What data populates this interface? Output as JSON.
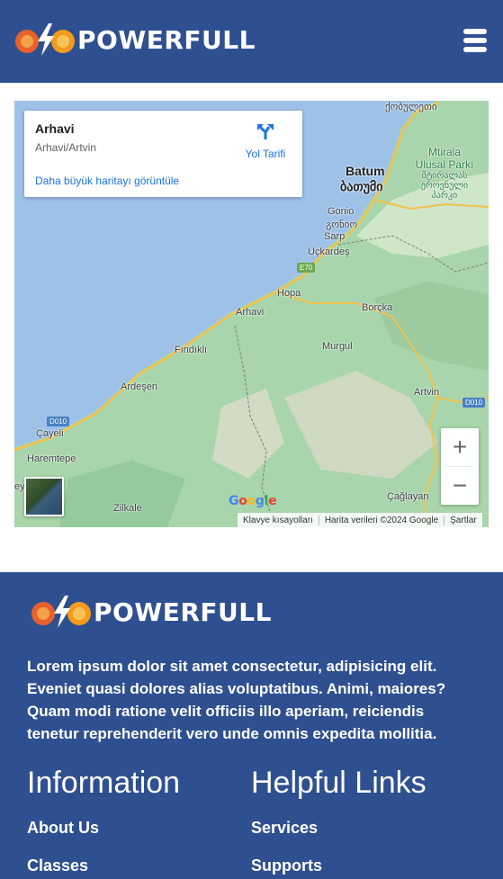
{
  "brand": {
    "name": "POWERFULL"
  },
  "header": {
    "menu_icon": "hamburger-icon"
  },
  "map": {
    "place_title": "Arhavi",
    "place_subtitle": "Arhavi/Artvin",
    "directions_label": "Yol Tarifi",
    "larger_map_link": "Daha büyük haritayı görüntüle",
    "zoom_in": "+",
    "zoom_out": "−",
    "google": "Google",
    "attribution": {
      "shortcuts": "Klavye kısayolları",
      "data": "Harita verileri ©2024 Google",
      "terms": "Şartlar"
    },
    "labels": {
      "kobuleti": "ქობულეთი",
      "batumi": "Batum",
      "batumi_geo": "ბათუმი",
      "park_1": "Mtirala",
      "park_2": "Ulusal Parkı",
      "park_geo_1": "მტირალას",
      "park_geo_2": "ეროვნული",
      "park_geo_3": "პარკი",
      "gonio": "Gonio",
      "gonio_geo": "გონიო",
      "sarp": "Sarp",
      "uckardes": "Üçkardeş",
      "hopa": "Hopa",
      "arhavi": "Arhavi",
      "borcka": "Borçka",
      "findikli": "Fındıklı",
      "murgul": "Murgul",
      "ardesen": "Ardeşen",
      "artvin": "Artvin",
      "cayeli": "Çayeli",
      "haremtepe": "Haremtepe",
      "zilkale": "Zilkale",
      "caglayan": "Çağlayan",
      "eys": "eys"
    },
    "roads": {
      "e70": "E70",
      "d010_left": "D010",
      "d010_right": "D010"
    }
  },
  "footer": {
    "description": "Lorem ipsum dolor sit amet consectetur, adipisicing elit. Eveniet quasi dolores alias voluptatibus. Animi, maiores? Quam modi ratione velit officiis illo aperiam, reiciendis tenetur reprehenderit vero unde omnis expedita mollitia.",
    "information": {
      "heading": "Information",
      "links": [
        "About Us",
        "Classes"
      ]
    },
    "helpful": {
      "heading": "Helpful Links",
      "links": [
        "Services",
        "Supports"
      ]
    }
  }
}
